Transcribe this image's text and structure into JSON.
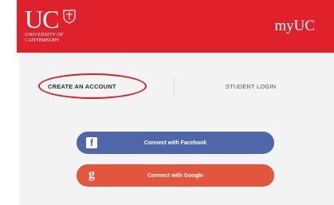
{
  "header": {
    "logo_main": "UC",
    "logo_sub_line1": "UNIVERSITY OF",
    "logo_sub_line2": "CANTERBURY",
    "brand": "myUC"
  },
  "tabs": {
    "create_account": "CREATE AN ACCOUNT",
    "student_login": "STUDENT LOGIN"
  },
  "social": {
    "facebook": "Connect with Facebook",
    "google": "Connect with Google",
    "facebook_icon": "f",
    "google_icon": "g"
  },
  "colors": {
    "header_red": "#e0212b",
    "facebook_blue": "#4f67aa",
    "google_red": "#e2563e",
    "annotation_oval": "#d61f26"
  }
}
